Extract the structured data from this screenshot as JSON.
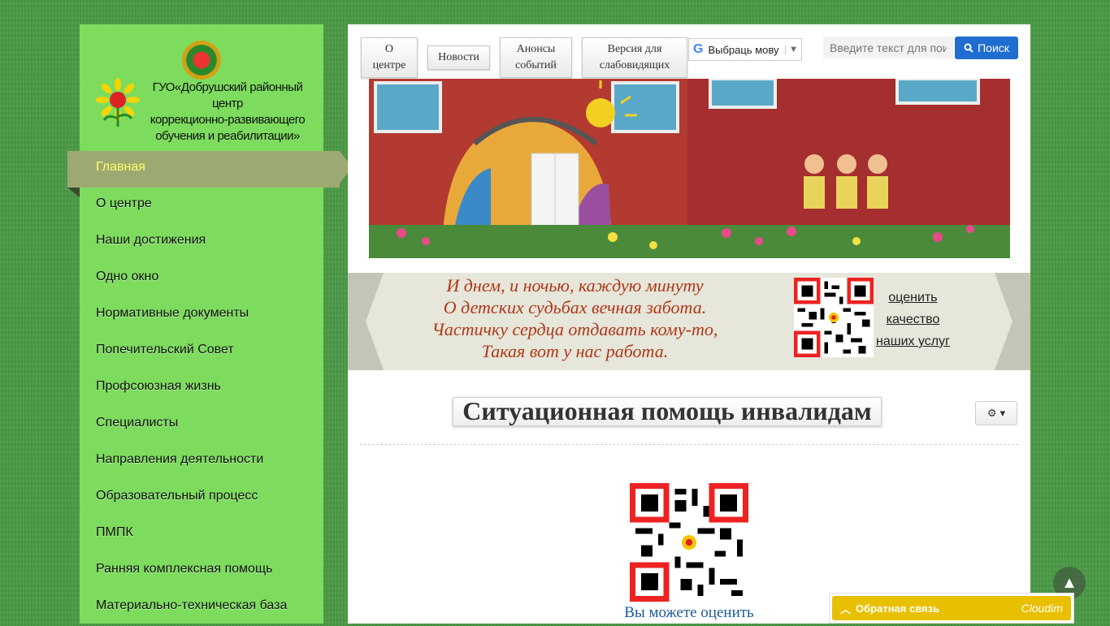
{
  "logo": {
    "org_lines": [
      "ГУО«Добрушский районный центр",
      "коррекционно-развивающего",
      "обучения и реабилитации»"
    ]
  },
  "sidebar": {
    "items": [
      {
        "label": "Главная",
        "active": true
      },
      {
        "label": "О центре"
      },
      {
        "label": "Наши достижения"
      },
      {
        "label": "Одно окно"
      },
      {
        "label": "Нормативные документы"
      },
      {
        "label": "Попечительский Совет"
      },
      {
        "label": "Профсоюзная жизнь"
      },
      {
        "label": "Специалисты"
      },
      {
        "label": "Направления деятельности"
      },
      {
        "label": "Образовательный процесс"
      },
      {
        "label": "ПМПК"
      },
      {
        "label": "Ранняя комплексная помощь"
      },
      {
        "label": "Материально-техническая база"
      }
    ]
  },
  "topnav": {
    "about_line1": "О",
    "about_line2": "центре",
    "news": "Новости",
    "events_line1": "Анонсы",
    "events_line2": "событий",
    "lowvision_line1": "Версия для",
    "lowvision_line2": "слабовидящих"
  },
  "lang": {
    "label": "Выбраць мову"
  },
  "search": {
    "placeholder": "Введите текст для поиска",
    "button": "Поиск"
  },
  "quote": {
    "lines": [
      "И днем, и ночью, каждую минуту",
      "О детских судьбах вечная забота.",
      "Частичку сердца отдавать кому-то,",
      "Такая вот у нас работа."
    ]
  },
  "rate": {
    "line1": "оценить",
    "line2": "качество",
    "line3": "наших услуг"
  },
  "page": {
    "title": "Ситуационная помощь инвалидам",
    "rate_text": "Вы можете оценить"
  },
  "feedback": {
    "label": "Обратная связь",
    "brand": "Cloudim"
  },
  "colors": {
    "sidebar": "#7ddc5e",
    "active": "#9caa72",
    "quote_text": "#b03818",
    "search_btn": "#1e6dd0",
    "feedback": "#e8c000"
  }
}
